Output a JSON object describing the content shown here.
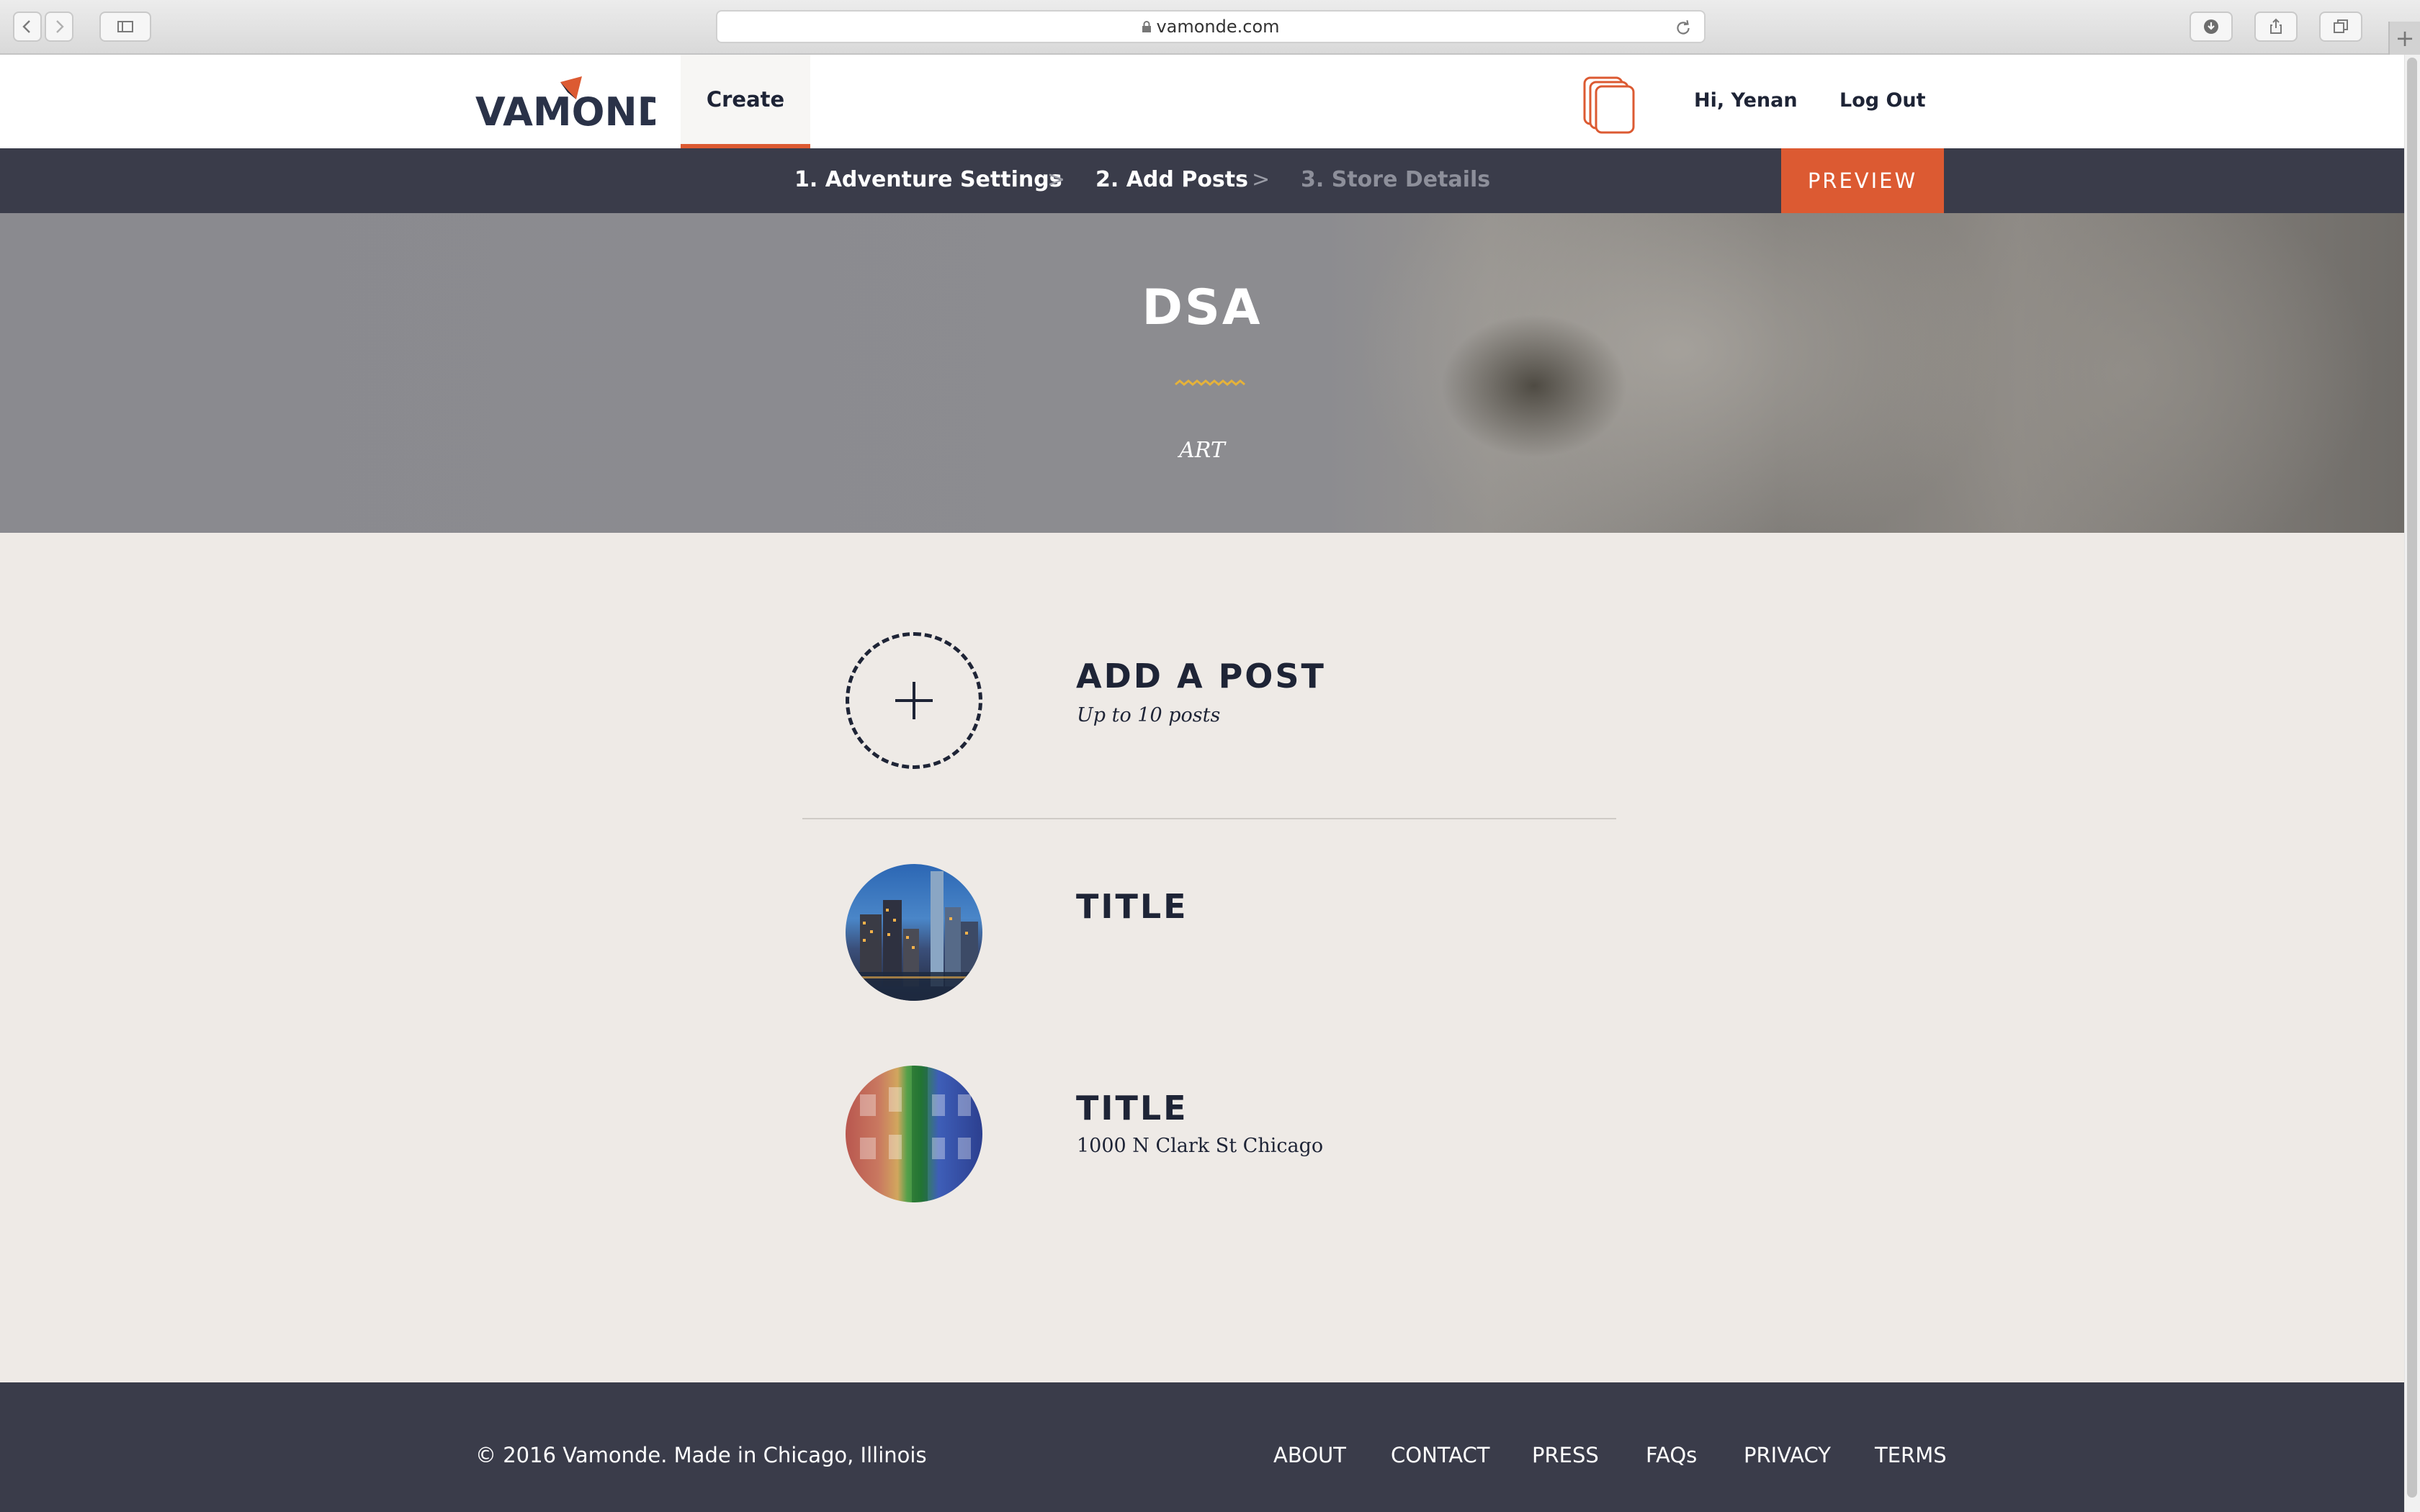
{
  "browser": {
    "url": "vamonde.com"
  },
  "header": {
    "logo_text": "VAMONDE",
    "nav_create": "Create",
    "greeting": "Hi, Yenan",
    "logout": "Log Out"
  },
  "steps": {
    "step1": "1. Adventure Settings",
    "step2": "2. Add Posts",
    "step3": "3. Store Details",
    "separator": ">",
    "preview": "PREVIEW"
  },
  "hero": {
    "title": "DSA",
    "category": "ART"
  },
  "add_post": {
    "title": "ADD A POST",
    "subtitle": "Up to 10 posts"
  },
  "posts": [
    {
      "title": "TITLE",
      "address": ""
    },
    {
      "title": "TITLE",
      "address": "1000 N Clark St Chicago"
    }
  ],
  "footer": {
    "copyright": "© 2016 Vamonde. Made in Chicago, Illinois",
    "links": [
      "ABOUT",
      "CONTACT",
      "PRESS",
      "FAQs",
      "PRIVACY",
      "TERMS"
    ]
  },
  "colors": {
    "accent": "#dc5a32",
    "navy": "#1e2436",
    "bar": "#3a3c4a",
    "page_bg": "#eeeae6"
  }
}
